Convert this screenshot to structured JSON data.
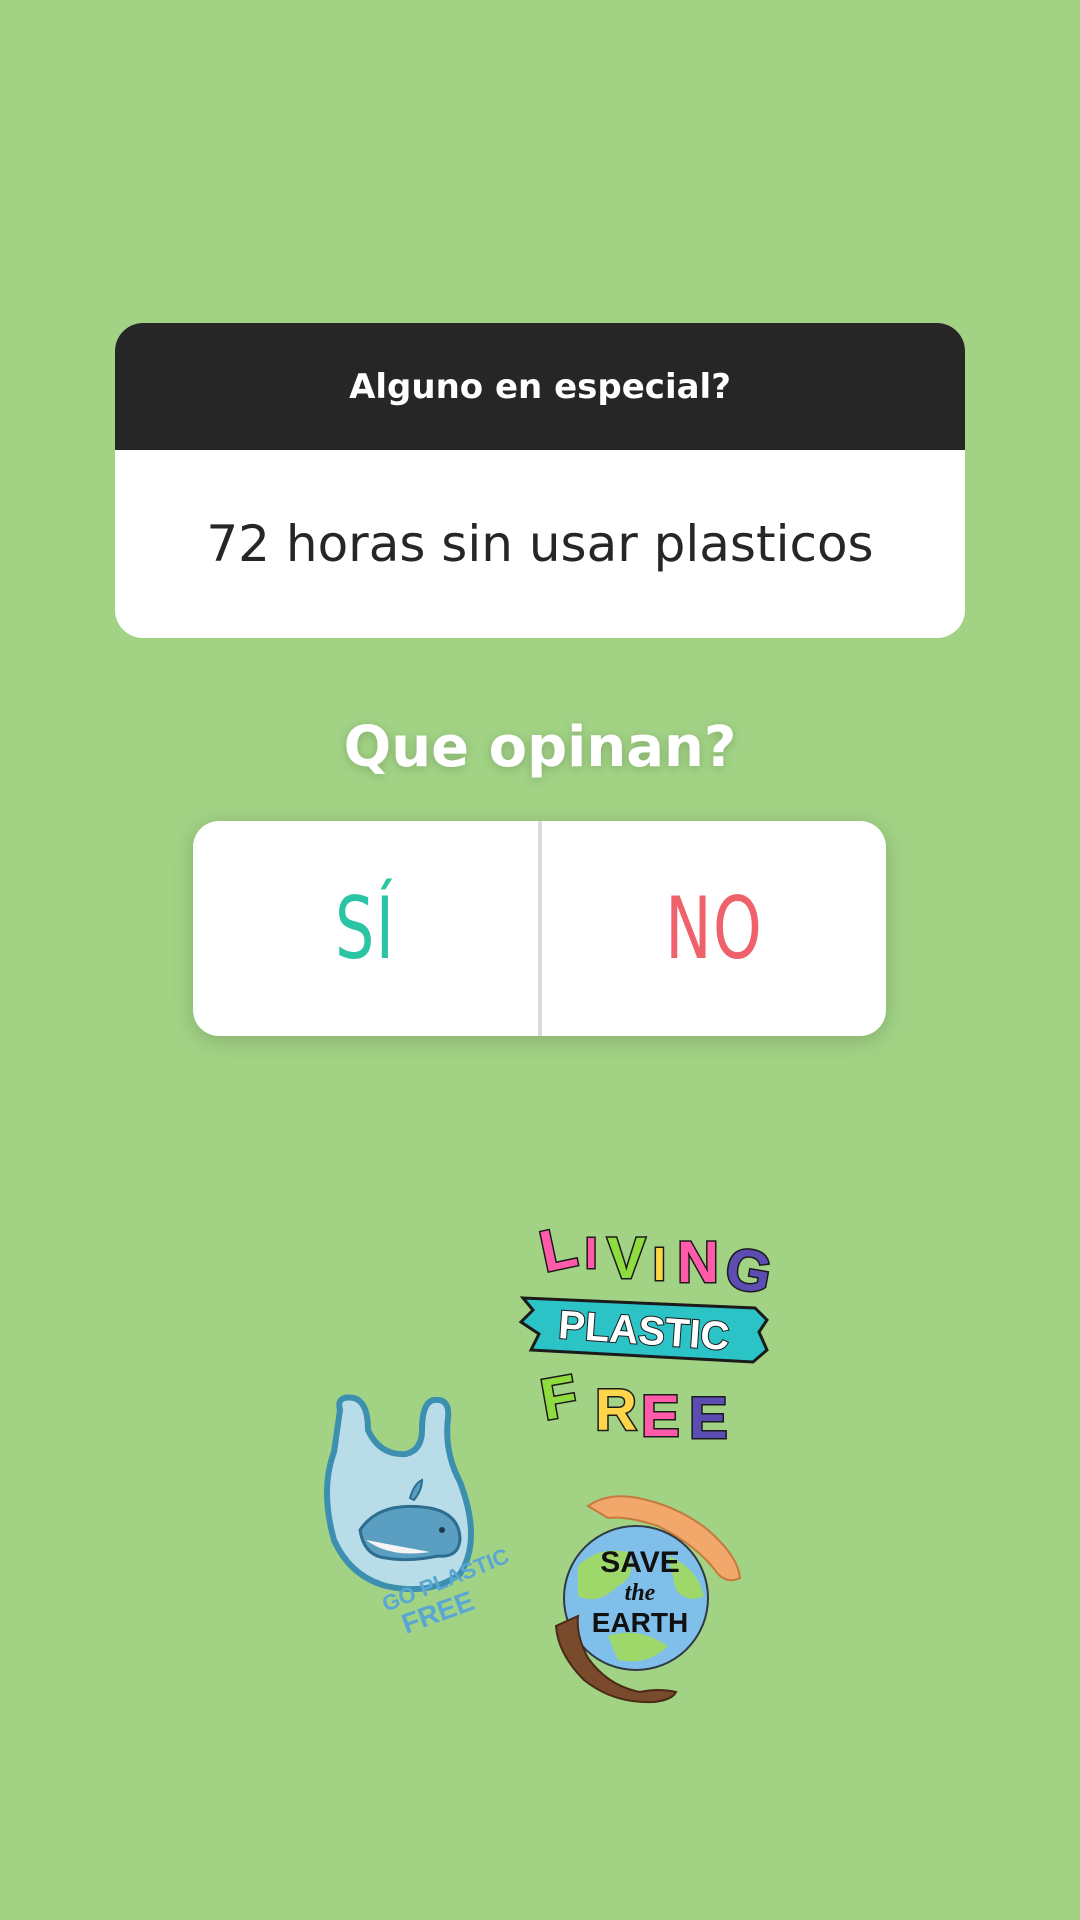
{
  "question_sticker": {
    "prompt": "Alguno en especial?",
    "answer": "72 horas sin usar plasticos"
  },
  "poll": {
    "question": "Que opinan?",
    "options": [
      {
        "label": "SÍ",
        "color": "#2bc4a4"
      },
      {
        "label": "NO",
        "color": "#f0626b"
      }
    ]
  },
  "stickers": {
    "living_plastic_free": {
      "line1": [
        "L",
        "I",
        "V",
        "I",
        "N",
        "G"
      ],
      "line2": "PLASTIC",
      "line3": [
        "F",
        "R",
        "E",
        "E"
      ]
    },
    "go_plastic_free": {
      "line1": "GO PLASTIC",
      "line2": "FREE"
    },
    "save_the_earth": {
      "line1": "SAVE",
      "line2": "the",
      "line3": "EARTH"
    }
  },
  "colors": {
    "background": "#a2d385",
    "header_bg": "#262626",
    "answer_text": "#262626"
  }
}
